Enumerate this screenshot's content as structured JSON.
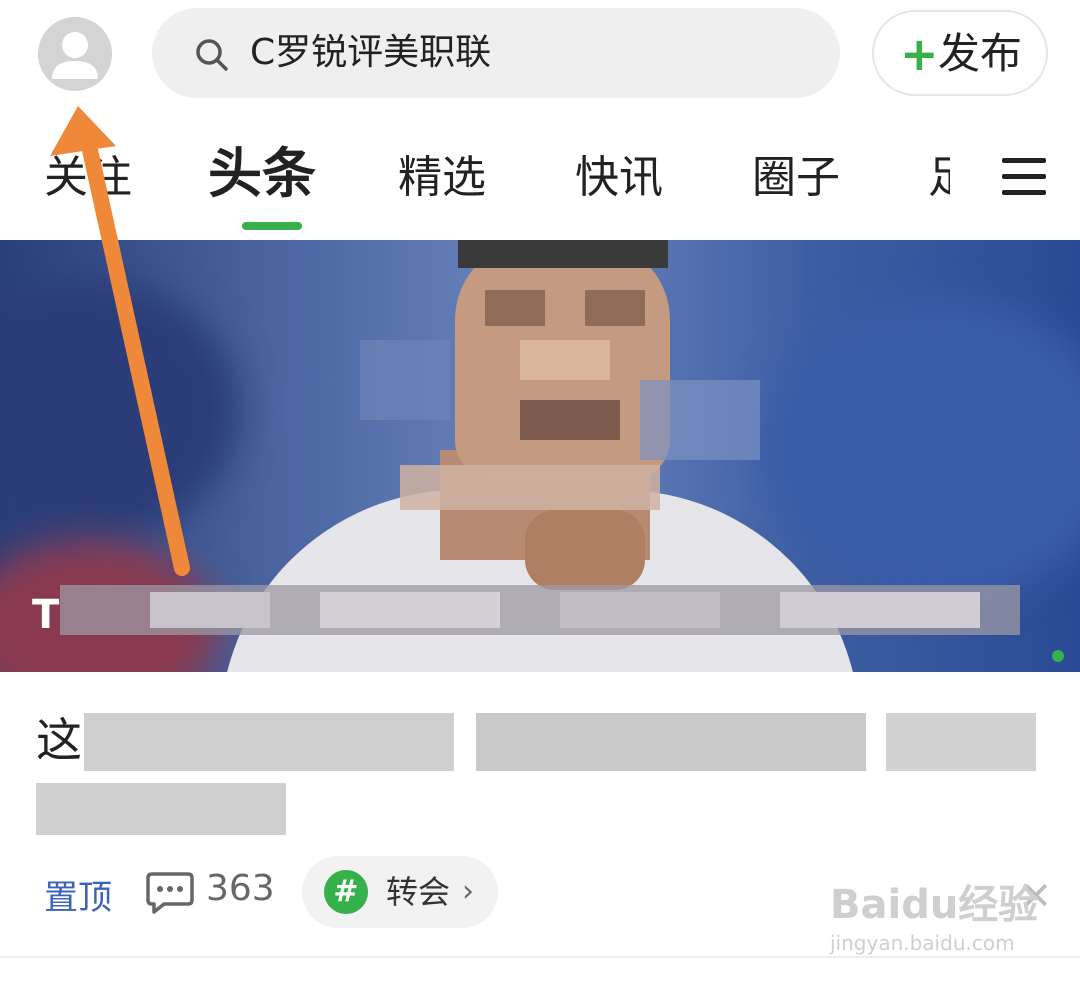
{
  "search": {
    "query": "C罗锐评美职联"
  },
  "publish": {
    "plus": "+",
    "label": "发布"
  },
  "tabs": [
    {
      "label": "关注"
    },
    {
      "label": "头条"
    },
    {
      "label": "精选"
    },
    {
      "label": "快讯"
    },
    {
      "label": "圈子"
    },
    {
      "label": "足"
    }
  ],
  "hero": {
    "caption_visible": "T"
  },
  "article": {
    "title_visible": "这"
  },
  "meta": {
    "pin_label": "置顶",
    "comment_count": "363",
    "topic_hash": "#",
    "topic_label": "转会",
    "topic_chevron": "›",
    "close": "✕"
  },
  "watermark": {
    "brand": "Baidu经验",
    "url": "jingyan.baidu.com"
  },
  "colors": {
    "accent_green": "#36b04a",
    "pin_blue": "#3b63b8",
    "arrow_orange": "#f0883a"
  },
  "icons": {
    "avatar": "avatar-icon",
    "search": "search-icon",
    "menu": "menu-icon",
    "comment": "comment-icon",
    "close": "close-icon"
  }
}
